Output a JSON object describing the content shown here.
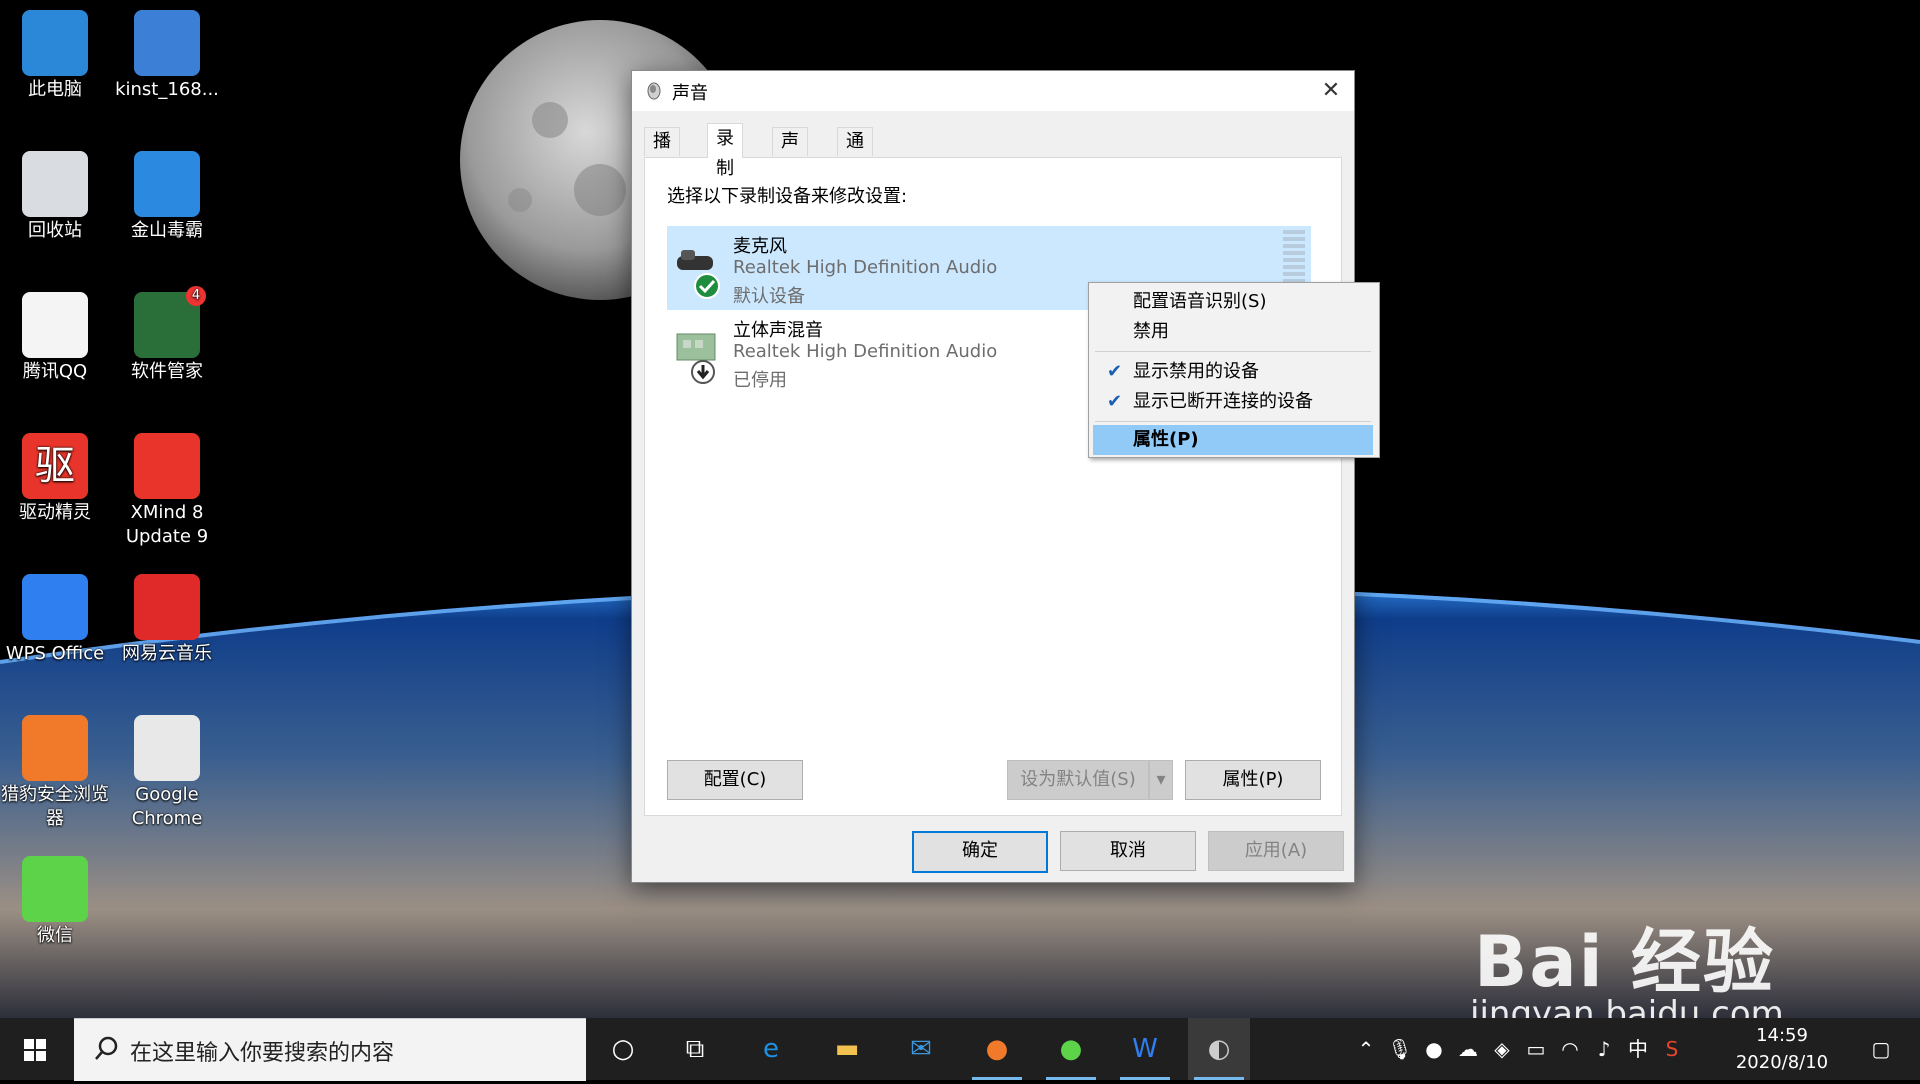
{
  "desktop": {
    "icons": [
      {
        "label": "此电脑",
        "icon": "computer-icon"
      },
      {
        "label": "kinst_168...",
        "icon": "installer-icon"
      },
      {
        "label": "回收站",
        "icon": "recycle-bin-icon"
      },
      {
        "label": "金山毒霸",
        "icon": "antivirus-icon"
      },
      {
        "label": "腾讯QQ",
        "icon": "qq-icon"
      },
      {
        "label": "软件管家",
        "icon": "software-manager-icon",
        "badge": "4"
      },
      {
        "label": "驱动精灵",
        "icon": "driver-genius-icon",
        "glyph": "驱"
      },
      {
        "label": "XMind 8\nUpdate 9",
        "icon": "xmind-icon"
      },
      {
        "label": "WPS Office",
        "icon": "wps-icon"
      },
      {
        "label": "网易云音乐",
        "icon": "netease-music-icon"
      },
      {
        "label": "猎豹安全浏览\n器",
        "icon": "cheetah-browser-icon"
      },
      {
        "label": "Google\nChrome",
        "icon": "chrome-icon"
      },
      {
        "label": "微信",
        "icon": "wechat-icon"
      }
    ]
  },
  "dialog": {
    "title": "声音",
    "tabs": [
      {
        "label": "播放",
        "active": false
      },
      {
        "label": "录制",
        "active": true
      },
      {
        "label": "声音",
        "active": false
      },
      {
        "label": "通信",
        "active": false
      }
    ],
    "instruction": "选择以下录制设备来修改设置:",
    "devices": [
      {
        "name": "麦克风",
        "driver": "Realtek High Definition Audio",
        "status": "默认设备",
        "selected": true,
        "icon": "microphone-icon",
        "status_icon": "check-badge-icon"
      },
      {
        "name": "立体声混音",
        "driver": "Realtek High Definition Audio",
        "status": "已停用",
        "selected": false,
        "icon": "sound-card-icon",
        "status_icon": "disabled-arrow-icon"
      }
    ],
    "buttons": {
      "configure": "配置(C)",
      "set_default": "设为默认值(S)",
      "properties": "属性(P)",
      "ok": "确定",
      "cancel": "取消",
      "apply": "应用(A)"
    }
  },
  "context_menu": {
    "items": [
      {
        "label": "配置语音识别(S)",
        "checked": false
      },
      {
        "label": "禁用",
        "checked": false
      },
      {
        "label": "显示禁用的设备",
        "checked": true
      },
      {
        "label": "显示已断开连接的设备",
        "checked": true
      },
      {
        "label": "属性(P)",
        "checked": false,
        "highlighted": true
      }
    ]
  },
  "taskbar": {
    "search_placeholder": "在这里输入你要搜索的内容",
    "ime": "中",
    "time": "14:59",
    "date": "2020/8/10"
  },
  "watermark": {
    "brand": "Bai 经验",
    "url": "jingyan.baidu.com"
  },
  "colors": {
    "accent": "#0078d7",
    "selection": "#cce8ff",
    "menu_highlight": "#91c9f7",
    "taskbar": "#1f1f1f"
  }
}
